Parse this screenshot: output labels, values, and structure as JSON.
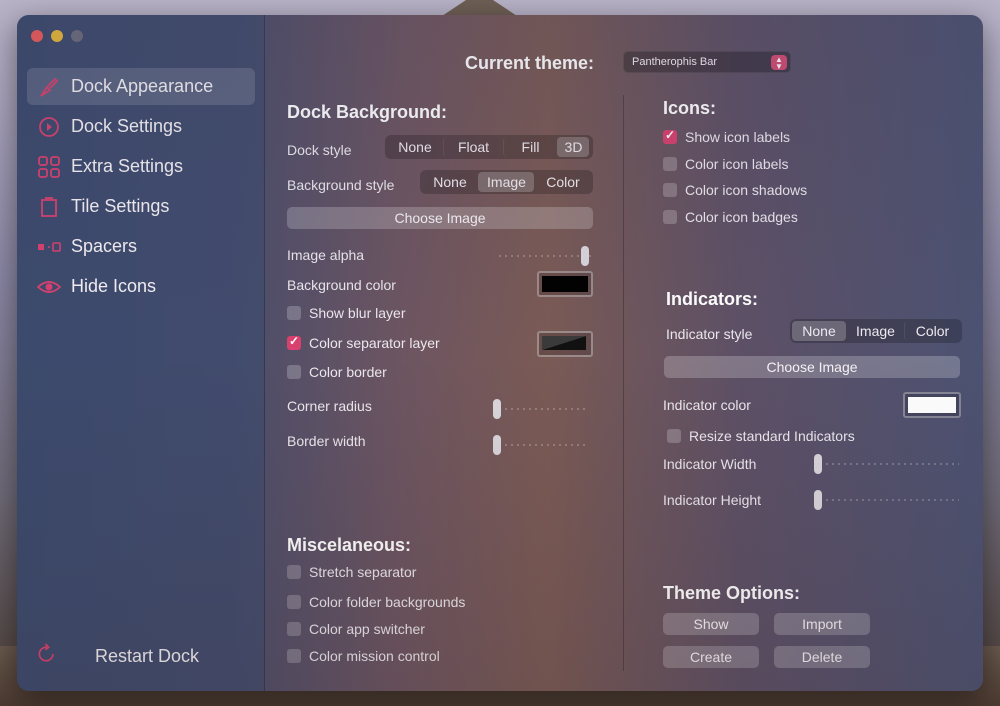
{
  "sidebar": {
    "items": [
      {
        "label": "Dock Appearance",
        "icon": "brush-icon",
        "active": true
      },
      {
        "label": "Dock Settings",
        "icon": "dock-settings-icon"
      },
      {
        "label": "Extra Settings",
        "icon": "grid-icon"
      },
      {
        "label": "Tile Settings",
        "icon": "tile-icon"
      },
      {
        "label": "Spacers",
        "icon": "spacer-icon"
      },
      {
        "label": "Hide Icons",
        "icon": "eye-icon"
      }
    ],
    "restart_label": "Restart Dock"
  },
  "header": {
    "title": "Current theme:",
    "theme_value": "Pantherophis Bar"
  },
  "dock_background": {
    "title": "Dock Background:",
    "dock_style_label": "Dock style",
    "dock_style_options": [
      "None",
      "Float",
      "Fill",
      "3D"
    ],
    "dock_style_selected": "3D",
    "background_style_label": "Background style",
    "background_style_options": [
      "None",
      "Image",
      "Color"
    ],
    "background_style_selected": "Image",
    "choose_image_label": "Choose Image",
    "image_alpha_label": "Image alpha",
    "image_alpha_value": 0.95,
    "background_color_label": "Background color",
    "background_color": "#000000",
    "show_blur_label": "Show blur layer",
    "show_blur_checked": false,
    "color_separator_label": "Color separator layer",
    "color_separator_checked": true,
    "color_border_label": "Color border",
    "color_border_checked": false,
    "corner_radius_label": "Corner radius",
    "corner_radius_value": 0,
    "border_width_label": "Border width",
    "border_width_value": 0
  },
  "misc": {
    "title": "Miscelaneous:",
    "items": [
      {
        "label": "Stretch separator",
        "checked": false
      },
      {
        "label": "Color folder backgrounds",
        "checked": false
      },
      {
        "label": "Color app switcher",
        "checked": false
      },
      {
        "label": "Color mission control",
        "checked": false
      }
    ]
  },
  "icons": {
    "title": "Icons:",
    "items": [
      {
        "label": "Show icon labels",
        "checked": true
      },
      {
        "label": "Color icon labels",
        "checked": false
      },
      {
        "label": "Color icon shadows",
        "checked": false
      },
      {
        "label": "Color icon badges",
        "checked": false
      }
    ]
  },
  "indicators": {
    "title": "Indicators:",
    "style_label": "Indicator style",
    "style_options": [
      "None",
      "Image",
      "Color"
    ],
    "style_selected": "None",
    "choose_image_label": "Choose Image",
    "color_label": "Indicator color",
    "color": "#ffffff",
    "resize_label": "Resize standard Indicators",
    "resize_checked": false,
    "width_label": "Indicator Width",
    "width_value": 0,
    "height_label": "Indicator Height",
    "height_value": 0
  },
  "theme_options": {
    "title": "Theme Options:",
    "show_label": "Show",
    "import_label": "Import",
    "create_label": "Create",
    "delete_label": "Delete"
  },
  "colors": {
    "accent": "#d9416e",
    "traffic_red": "#ec5b5a",
    "traffic_yellow": "#e8b73a"
  }
}
